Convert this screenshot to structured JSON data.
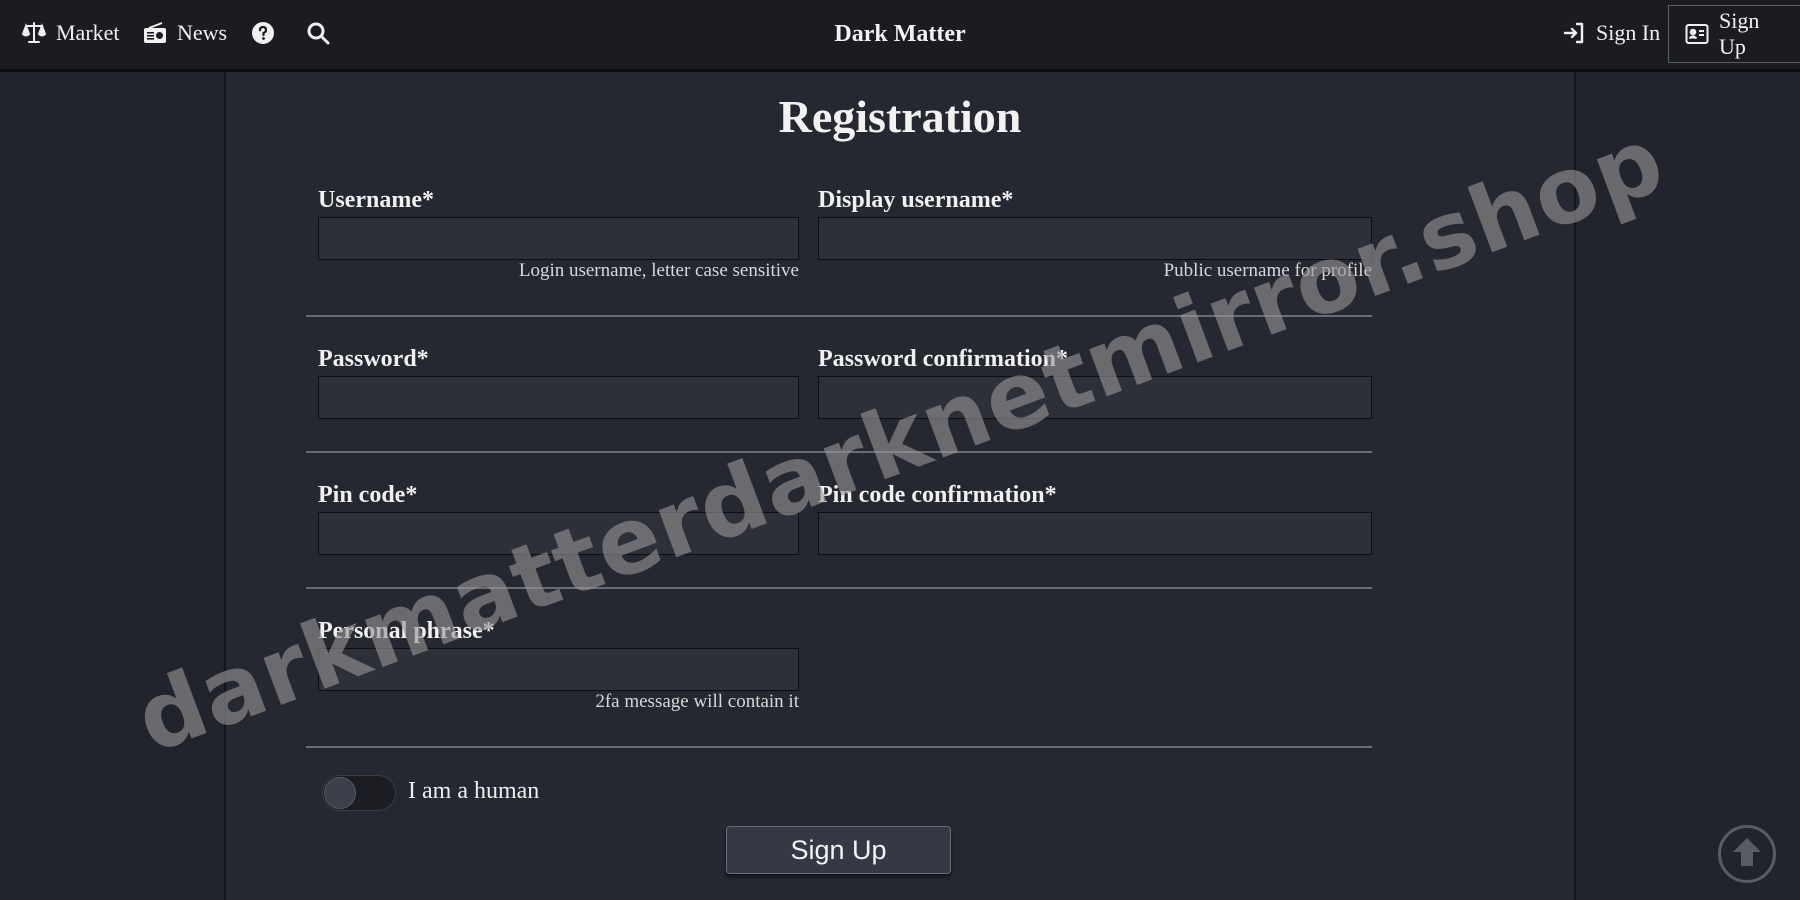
{
  "nav": {
    "market_label": "Market",
    "news_label": "News",
    "brand": "Dark Matter",
    "sign_in_label": "Sign In",
    "sign_up_label": "Sign Up"
  },
  "form": {
    "title": "Registration",
    "username": {
      "label": "Username*",
      "value": "",
      "hint": "Login username, letter case sensitive"
    },
    "display_username": {
      "label": "Display username*",
      "value": "",
      "hint": "Public username for profile"
    },
    "password": {
      "label": "Password*",
      "value": ""
    },
    "password_confirmation": {
      "label": "Password confirmation*",
      "value": ""
    },
    "pin_code": {
      "label": "Pin code*",
      "value": ""
    },
    "pin_code_confirmation": {
      "label": "Pin code confirmation*",
      "value": ""
    },
    "personal_phrase": {
      "label": "Personal phrase*",
      "value": "",
      "hint": "2fa message will contain it"
    },
    "human_toggle": {
      "label": "I am a human",
      "checked": false
    },
    "submit_label": "Sign Up"
  },
  "watermark": "darkmatterdarknetmirror.shop",
  "icons": {
    "market": "scale-icon",
    "news": "radio-icon",
    "help": "question-circle-icon",
    "search": "search-icon",
    "sign_in": "sign-in-icon",
    "sign_up": "id-card-icon",
    "scroll_top": "arrow-up-circle-icon"
  },
  "colors": {
    "background": "#22242d",
    "topbar": "#1b1c22",
    "panel": "#252731",
    "input": "#2d2f39",
    "button": "#363945"
  }
}
